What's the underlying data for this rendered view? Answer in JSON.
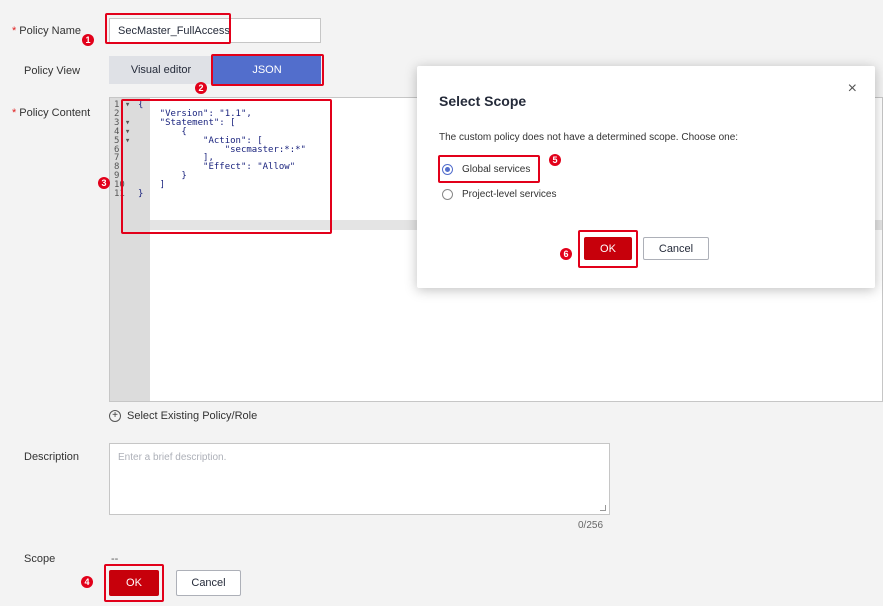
{
  "form": {
    "policy_name_label": "Policy Name",
    "policy_name_value": "SecMaster_FullAccess",
    "policy_view_label": "Policy View",
    "view_tabs": [
      "Visual editor",
      "JSON"
    ],
    "policy_content_label": "Policy Content",
    "code_lines": [
      {
        "num": "1",
        "fold": "▾",
        "text": "{"
      },
      {
        "num": "2",
        "fold": "",
        "text": "    \"Version\": \"1.1\","
      },
      {
        "num": "3",
        "fold": "▾",
        "text": "    \"Statement\": ["
      },
      {
        "num": "4",
        "fold": "▾",
        "text": "        {"
      },
      {
        "num": "5",
        "fold": "▾",
        "text": "            \"Action\": ["
      },
      {
        "num": "6",
        "fold": "",
        "text": "                \"secmaster:*:*\""
      },
      {
        "num": "7",
        "fold": "",
        "text": "            ],"
      },
      {
        "num": "8",
        "fold": "",
        "text": "            \"Effect\": \"Allow\""
      },
      {
        "num": "9",
        "fold": "",
        "text": "        }"
      },
      {
        "num": "10",
        "fold": "",
        "text": "    ]"
      },
      {
        "num": "11",
        "fold": "",
        "text": "}"
      }
    ],
    "select_existing": "Select Existing Policy/Role",
    "description_label": "Description",
    "description_placeholder": "Enter a brief description.",
    "description_counter": "0/256",
    "scope_label": "Scope",
    "scope_value": "--",
    "ok_label": "OK",
    "cancel_label": "Cancel"
  },
  "modal": {
    "title": "Select Scope",
    "close_glyph": "×",
    "description": "The custom policy does not have a determined scope. Choose one:",
    "options": [
      {
        "label": "Global services",
        "selected": true
      },
      {
        "label": "Project-level services",
        "selected": false
      }
    ],
    "ok_label": "OK",
    "cancel_label": "Cancel"
  },
  "steps": [
    "1",
    "2",
    "3",
    "4",
    "5",
    "6"
  ],
  "colors": {
    "primary": "#c7000b",
    "highlight": "#e2001a",
    "tab_active": "#526ecc",
    "radio_selected": "#526ecc"
  }
}
